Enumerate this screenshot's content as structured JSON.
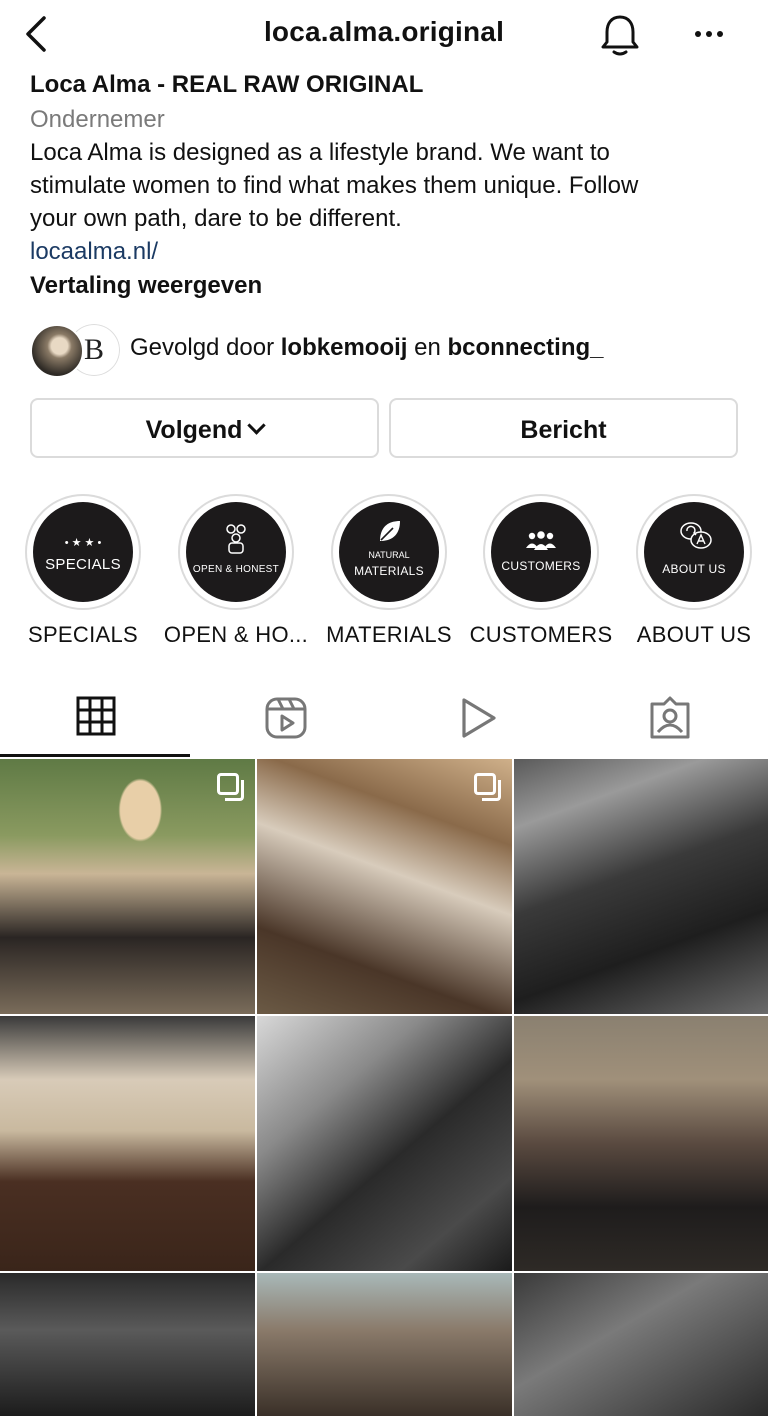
{
  "header": {
    "username": "loca.alma.original"
  },
  "profile": {
    "name": "Loca Alma - REAL RAW ORIGINAL",
    "category": "Ondernemer",
    "bio_lines": [
      "Loca Alma is designed as a lifestyle brand. We want to",
      "stimulate women to find what makes them unique. Follow",
      "your own path, dare to be different."
    ],
    "link": "locaalma.nl/",
    "translate_label": "Vertaling weergeven"
  },
  "followed_by": {
    "prefix": "Gevolgd door ",
    "user1": "lobkemooij",
    "joiner": " en ",
    "user2": "bconnecting_"
  },
  "buttons": {
    "following_label": "Volgend",
    "message_label": "Bericht"
  },
  "highlights": [
    {
      "label": "SPECIALS",
      "cover_top": "• ★ ★ •",
      "cover_main": "SPECIALS",
      "icon": "stars-icon"
    },
    {
      "label": "OPEN & HO...",
      "cover_top": "",
      "cover_main": "OPEN & HONEST",
      "icon": "people-icon"
    },
    {
      "label": "MATERIALS",
      "cover_top": "NATURAL",
      "cover_main": "MATERIALS",
      "icon": "leaf-icon"
    },
    {
      "label": "CUSTOMERS",
      "cover_top": "",
      "cover_main": "CUSTOMERS",
      "icon": "group-icon"
    },
    {
      "label": "ABOUT US",
      "cover_top": "",
      "cover_main": "ABOUT US",
      "icon": "qa-icon"
    }
  ],
  "tabs": [
    {
      "name": "grid-tab",
      "icon": "grid-icon",
      "active": true
    },
    {
      "name": "reels-tab",
      "icon": "reels-icon",
      "active": false
    },
    {
      "name": "videos-tab",
      "icon": "play-icon",
      "active": false
    },
    {
      "name": "tagged-tab",
      "icon": "tagged-icon",
      "active": false
    }
  ],
  "colors": {
    "link": "#1b3a63",
    "muted": "#7a7a7a",
    "border": "#dbdbdb"
  }
}
